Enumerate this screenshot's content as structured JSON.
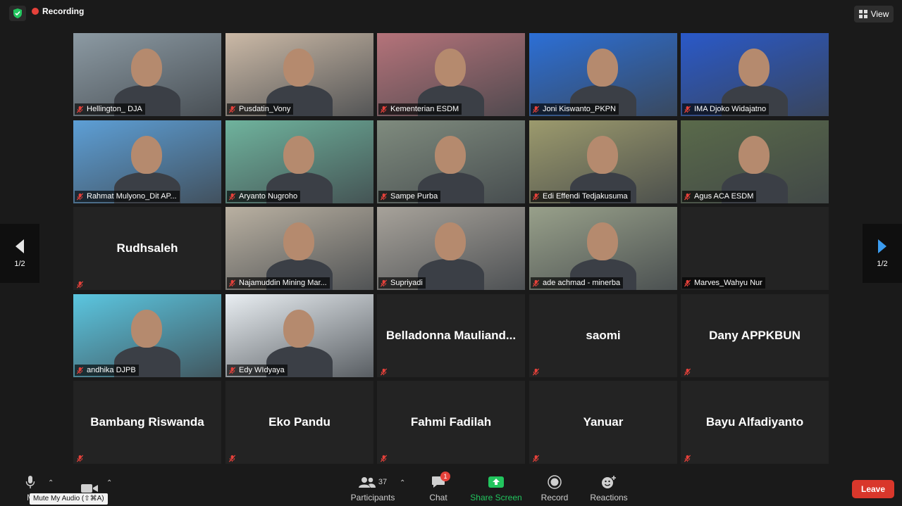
{
  "topbar": {
    "recording_label": "Recording",
    "view_label": "View"
  },
  "nav": {
    "page_left": "1/2",
    "page_right": "1/2"
  },
  "participants": [
    {
      "name": "Hellington_ DJA",
      "video": true,
      "bg": "#8c9aa3"
    },
    {
      "name": "Pusdatin_Vony",
      "video": true,
      "bg": "#cbb9a6"
    },
    {
      "name": "Kementerian ESDM",
      "video": true,
      "bg": "#b5737a"
    },
    {
      "name": "Joni Kiswanto_PKPN",
      "video": true,
      "bg": "#2c6fd6"
    },
    {
      "name": "IMA Djoko Widajatno",
      "video": true,
      "bg": "#2a59c9"
    },
    {
      "name": "Rahmat Mulyono_Dit AP...",
      "video": true,
      "bg": "#5d9fd6"
    },
    {
      "name": "Aryanto Nugroho",
      "video": true,
      "bg": "#6fb39d"
    },
    {
      "name": "Sampe Purba",
      "video": true,
      "bg": "#7f8b7e",
      "active": true
    },
    {
      "name": "Edi Effendi Tedjakusuma",
      "video": true,
      "bg": "#9c9a6d"
    },
    {
      "name": "Agus ACA ESDM",
      "video": true,
      "bg": "#5a6a4a"
    },
    {
      "name": "Rudhsaleh",
      "video": false
    },
    {
      "name": "Najamuddin Mining Mar...",
      "video": true,
      "bg": "#b9b0a1"
    },
    {
      "name": "Supriyadi",
      "video": true,
      "bg": "#a7a29a"
    },
    {
      "name": "ade achmad - minerba",
      "video": true,
      "bg": "#98a08a"
    },
    {
      "name": "Marves_Wahyu Nur",
      "video": false,
      "label_only": true
    },
    {
      "name": "andhika DJPB",
      "video": true,
      "bg": "#5bc6e0"
    },
    {
      "name": "Edy WIdyaya",
      "video": true,
      "bg": "#e9eef2"
    },
    {
      "name": "Belladonna Mauliand...",
      "video": false
    },
    {
      "name": "saomi",
      "video": false
    },
    {
      "name": "Dany APPKBUN",
      "video": false
    },
    {
      "name": "Bambang Riswanda",
      "video": false
    },
    {
      "name": "Eko Pandu",
      "video": false
    },
    {
      "name": "Fahmi Fadilah",
      "video": false
    },
    {
      "name": "Yanuar",
      "video": false
    },
    {
      "name": "Bayu Alfadiyanto",
      "video": false
    }
  ],
  "toolbar": {
    "mute_label": "M",
    "mute_tooltip": "Mute My Audio (⇧⌘A)",
    "participants_label": "Participants",
    "participants_count": "37",
    "chat_label": "Chat",
    "chat_badge": "1",
    "share_label": "Share Screen",
    "record_label": "Record",
    "reactions_label": "Reactions",
    "leave_label": "Leave"
  },
  "colors": {
    "share": "#22c55e",
    "leave": "#d9372b",
    "active_border": "#d8f05a",
    "recording_dot": "#e5413a"
  }
}
